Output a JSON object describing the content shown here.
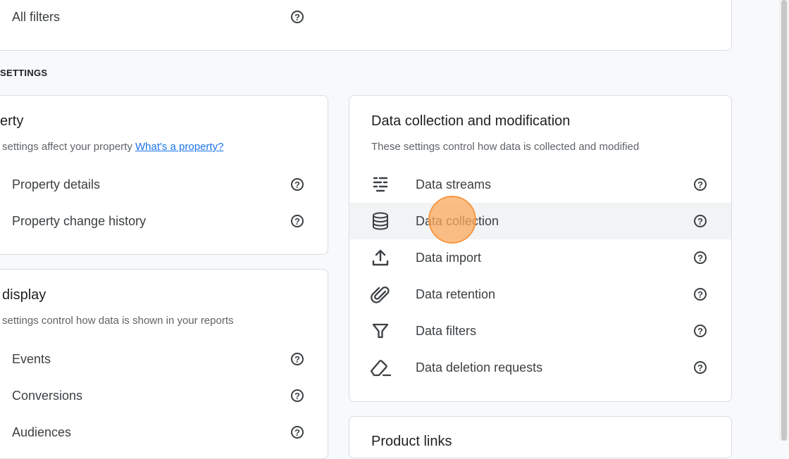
{
  "top_card": {
    "item": "All filters"
  },
  "section": {
    "label": "SETTINGS"
  },
  "property_card": {
    "title": "erty",
    "subtitle_text": "settings affect your property",
    "subtitle_link": "What's a property?",
    "items": [
      {
        "label": "Property details"
      },
      {
        "label": "Property change history"
      }
    ]
  },
  "display_card": {
    "title": "display",
    "subtitle": "settings control how data is shown in your reports",
    "items": [
      {
        "label": "Events"
      },
      {
        "label": "Conversions"
      },
      {
        "label": "Audiences"
      }
    ]
  },
  "data_card": {
    "title": "Data collection and modification",
    "subtitle": "These settings control how data is collected and modified",
    "items": [
      {
        "label": "Data streams",
        "icon": "data-streams-icon"
      },
      {
        "label": "Data collection",
        "icon": "database-icon"
      },
      {
        "label": "Data import",
        "icon": "upload-icon"
      },
      {
        "label": "Data retention",
        "icon": "paperclip-icon"
      },
      {
        "label": "Data filters",
        "icon": "filter-icon"
      },
      {
        "label": "Data deletion requests",
        "icon": "eraser-icon"
      }
    ]
  },
  "links_card": {
    "title": "Product links"
  },
  "help_glyph": "?",
  "colors": {
    "accent": "#1a73e8",
    "hover_row": "#f1f3f4",
    "click_marker": "#fbaa5c"
  }
}
